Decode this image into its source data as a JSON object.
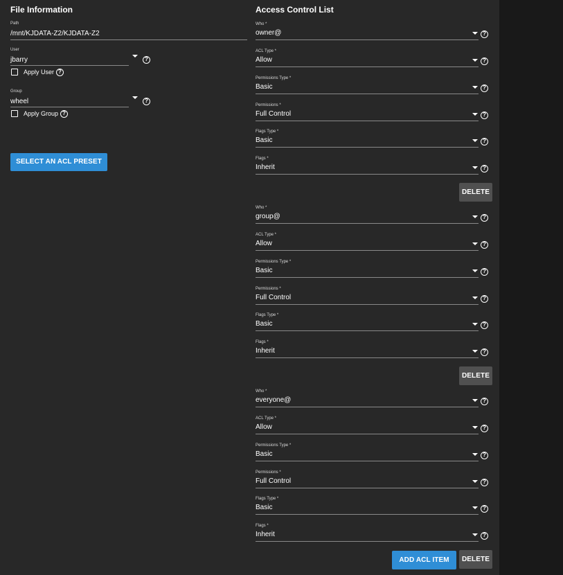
{
  "file_info": {
    "title": "File Information",
    "path": {
      "label": "Path",
      "value": "/mnt/KJDATA-Z2/KJDATA-Z2"
    },
    "user": {
      "label": "User",
      "value": "jbarry",
      "apply_label": "Apply User"
    },
    "group": {
      "label": "Group",
      "value": "wheel",
      "apply_label": "Apply Group"
    },
    "preset_button": "SELECT AN ACL PRESET",
    "help_glyph": "?"
  },
  "acl": {
    "title": "Access Control List",
    "add_button": "ADD ACL ITEM",
    "entries": [
      {
        "who": {
          "label": "Who *",
          "value": "owner@"
        },
        "acl_type": {
          "label": "ACL Type *",
          "value": "Allow"
        },
        "permissions_type": {
          "label": "Permissions Type *",
          "value": "Basic"
        },
        "permissions": {
          "label": "Permissions *",
          "value": "Full Control"
        },
        "flags_type": {
          "label": "Flags Type *",
          "value": "Basic"
        },
        "flags": {
          "label": "Flags *",
          "value": "Inherit"
        },
        "delete_label": "DELETE"
      },
      {
        "who": {
          "label": "Who *",
          "value": "group@"
        },
        "acl_type": {
          "label": "ACL Type *",
          "value": "Allow"
        },
        "permissions_type": {
          "label": "Permissions Type *",
          "value": "Basic"
        },
        "permissions": {
          "label": "Permissions *",
          "value": "Full Control"
        },
        "flags_type": {
          "label": "Flags Type *",
          "value": "Basic"
        },
        "flags": {
          "label": "Flags *",
          "value": "Inherit"
        },
        "delete_label": "DELETE"
      },
      {
        "who": {
          "label": "Who *",
          "value": "everyone@"
        },
        "acl_type": {
          "label": "ACL Type *",
          "value": "Allow"
        },
        "permissions_type": {
          "label": "Permissions Type *",
          "value": "Basic"
        },
        "permissions": {
          "label": "Permissions *",
          "value": "Full Control"
        },
        "flags_type": {
          "label": "Flags Type *",
          "value": "Basic"
        },
        "flags": {
          "label": "Flags *",
          "value": "Inherit"
        },
        "delete_label": "DELETE"
      }
    ]
  },
  "icons": {
    "help": "help-circle-icon",
    "dropdown": "caret-down-icon",
    "checkbox": "checkbox-unchecked"
  },
  "colors": {
    "background": "#282828",
    "outer": "#191919",
    "primary": "#2f8ed6",
    "secondary": "#505050",
    "text": "#ffffff"
  }
}
